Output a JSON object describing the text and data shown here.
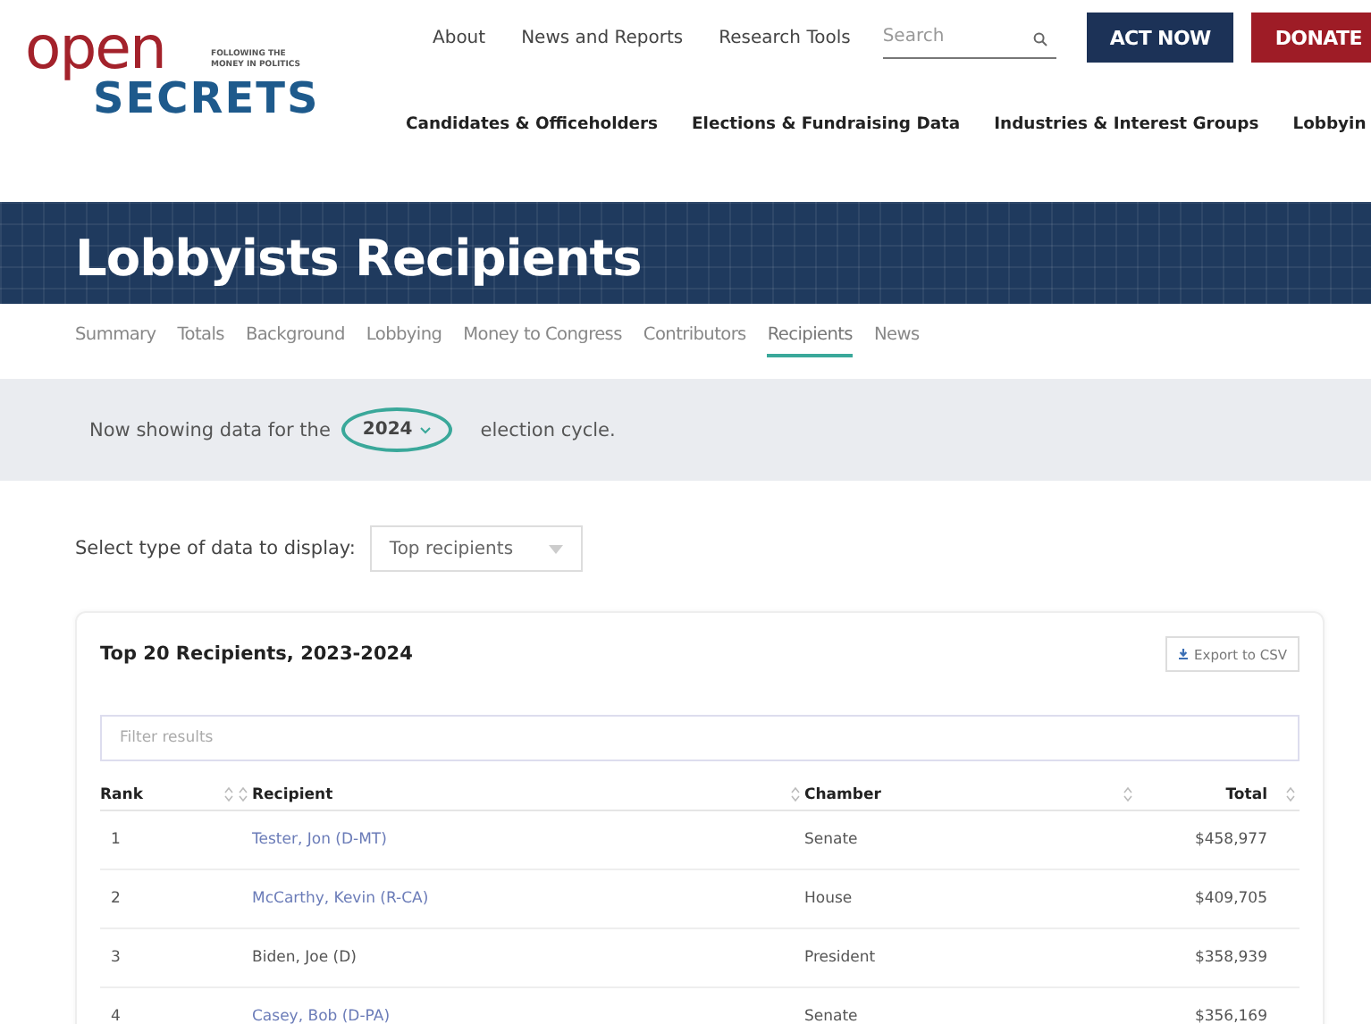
{
  "logo": {
    "word_top": "open",
    "tagline": "FOLLOWING THE MONEY IN POLITICS",
    "word_bottom": "SECRETS"
  },
  "top_nav": [
    "About",
    "News and Reports",
    "Research Tools"
  ],
  "search": {
    "placeholder": "Search"
  },
  "action_buttons": [
    {
      "label": "ACT NOW",
      "kind": "navy"
    },
    {
      "label": "DONATE",
      "kind": "red"
    }
  ],
  "main_nav": [
    "Candidates & Officeholders",
    "Elections & Fundraising Data",
    "Industries & Interest Groups",
    "Lobbyin"
  ],
  "banner": {
    "title": "Lobbyists Recipients"
  },
  "tabs": [
    {
      "label": "Summary",
      "selected": false
    },
    {
      "label": "Totals",
      "selected": false
    },
    {
      "label": "Background",
      "selected": false
    },
    {
      "label": "Lobbying",
      "selected": false
    },
    {
      "label": "Money to Congress",
      "selected": false
    },
    {
      "label": "Contributors",
      "selected": false
    },
    {
      "label": "Recipients",
      "selected": true
    },
    {
      "label": "News",
      "selected": false
    }
  ],
  "cycle": {
    "before": "Now showing data for the",
    "value": "2024",
    "after": "election cycle."
  },
  "data_type": {
    "label": "Select type of data to display:",
    "value": "Top recipients"
  },
  "table_card": {
    "title": "Top 20 Recipients, 2023-2024",
    "export": "Export to CSV",
    "filter": {
      "placeholder": "Filter results"
    },
    "columns": [
      "Rank",
      "Recipient",
      "Chamber",
      "Total"
    ],
    "rows": [
      {
        "rank": "1",
        "recipient": "Tester, Jon (D-MT)",
        "link": true,
        "chamber": "Senate",
        "total": "$458,977"
      },
      {
        "rank": "2",
        "recipient": "McCarthy, Kevin (R-CA)",
        "link": true,
        "chamber": "House",
        "total": "$409,705"
      },
      {
        "rank": "3",
        "recipient": "Biden, Joe (D)",
        "link": false,
        "chamber": "President",
        "total": "$358,939"
      },
      {
        "rank": "4",
        "recipient": "Casey, Bob (D-PA)",
        "link": true,
        "chamber": "Senate",
        "total": "$356,169"
      }
    ]
  }
}
